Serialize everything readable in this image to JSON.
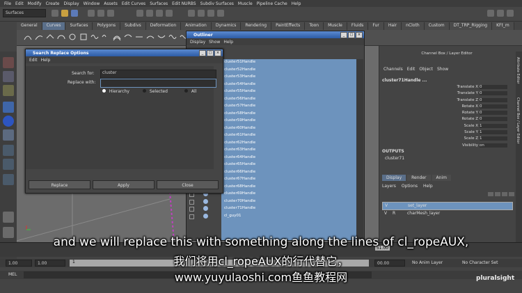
{
  "menubar": [
    "File",
    "Edit",
    "Modify",
    "Create",
    "Display",
    "Window",
    "Assets",
    "Edit Curves",
    "Surfaces",
    "Edit NURBS",
    "Subdiv Surfaces",
    "Muscle",
    "Pipeline Cache",
    "Help"
  ],
  "status": {
    "menuset": "Surfaces"
  },
  "shelf_tabs": [
    "General",
    "Curves",
    "Surfaces",
    "Polygons",
    "Subdivs",
    "Deformation",
    "Animation",
    "Dynamics",
    "Rendering",
    "PaintEffects",
    "Toon",
    "Muscle",
    "Fluids",
    "Fur",
    "Hair",
    "nCloth",
    "Custom",
    "DT_TRP_Rigging",
    "KFt_m"
  ],
  "viewport_menu": [
    "View",
    "Shading",
    "Lighting",
    "Show",
    "Renderer",
    "Panels"
  ],
  "dialog": {
    "title": "Search Replace Options",
    "menu": [
      "Edit",
      "Help"
    ],
    "search_label": "Search for:",
    "search_value": "cluster",
    "replace_label": "Replace with:",
    "replace_value": "",
    "radios": [
      "Hierarchy",
      "Selected",
      "All"
    ],
    "buttons": [
      "Replace",
      "Apply",
      "Close"
    ]
  },
  "outliner": {
    "title": "Outliner",
    "menu": [
      "Display",
      "Show",
      "Help"
    ],
    "items": [
      "cluster51Handle",
      "cluster52Handle",
      "cluster53Handle",
      "cluster54Handle",
      "cluster55Handle",
      "cluster56Handle",
      "cluster57Handle",
      "cluster58Handle",
      "cluster59Handle",
      "cluster60Handle",
      "cluster61Handle",
      "cluster62Handle",
      "cluster63Handle",
      "cluster64Handle",
      "cluster65Handle",
      "cluster66Handle",
      "cluster67Handle",
      "cluster68Handle",
      "cluster69Handle",
      "cluster70Handle",
      "cluster71Handle",
      "cl_guy01"
    ]
  },
  "channelbox": {
    "header": "Channel Box / Layer Editor",
    "menu": [
      "Channels",
      "Edit",
      "Object",
      "Show"
    ],
    "object": "cluster71Handle ...",
    "attrs": [
      {
        "name": "Translate X",
        "value": "0"
      },
      {
        "name": "Translate Y",
        "value": "0"
      },
      {
        "name": "Translate Z",
        "value": "0"
      },
      {
        "name": "Rotate X",
        "value": "0"
      },
      {
        "name": "Rotate Y",
        "value": "0"
      },
      {
        "name": "Rotate Z",
        "value": "0"
      },
      {
        "name": "Scale X",
        "value": "1"
      },
      {
        "name": "Scale Y",
        "value": "1"
      },
      {
        "name": "Scale Z",
        "value": "1"
      },
      {
        "name": "Visibility",
        "value": "on"
      }
    ],
    "outputs_label": "OUTPUTS",
    "output": "cluster71",
    "layer_tabs": [
      "Display",
      "Render",
      "Anim"
    ],
    "layer_menu": [
      "Layers",
      "Options",
      "Help"
    ],
    "layers": [
      {
        "v": "V",
        "r": "",
        "name": "set_layer"
      },
      {
        "v": "V",
        "r": "R",
        "name": "charMesh_layer"
      }
    ],
    "side_tabs": [
      "Attribute Editor",
      "Channel Box / Layer Editor"
    ]
  },
  "timeline": {
    "end_frame": "51.00",
    "start": "1.00",
    "start2": "1.00",
    "current": "1",
    "end2": "00.00",
    "anim_layer": "No Anim Layer",
    "char_set": "No Character Set"
  },
  "cmdline": {
    "label": "MEL"
  },
  "subtitles": {
    "english": "and we will replace this with something along the lines of cl_ropeAUX,",
    "chinese": "我们将用cl_ropeAUX的行代替它，",
    "url": "www.yuyulaoshi.com鱼鱼教程网"
  },
  "watermark": "pluralsight",
  "colors": {
    "selection": "#6d93bd",
    "titlebar": "#2d5ca6",
    "accent_tab": "#5a6f8a"
  }
}
